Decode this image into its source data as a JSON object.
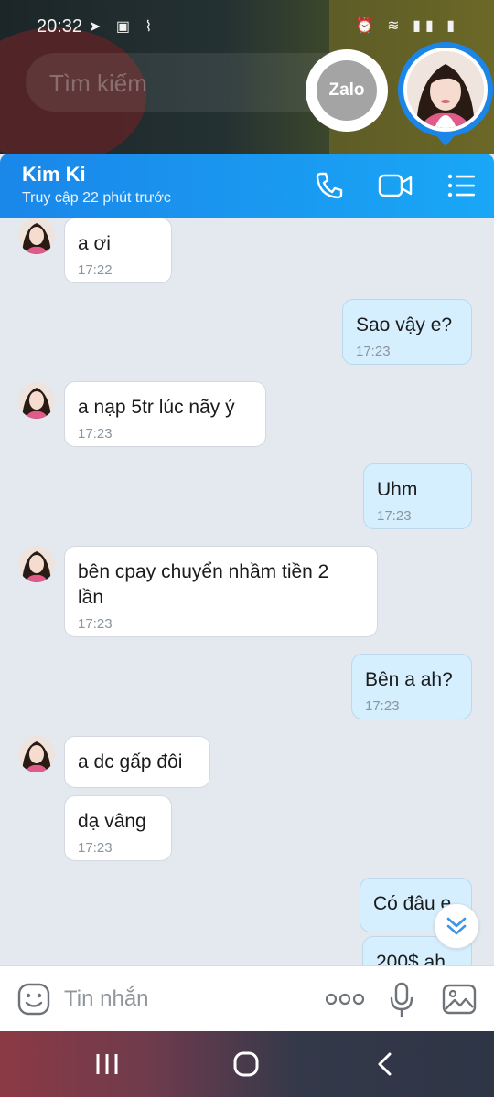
{
  "status_bar": {
    "time": "20:32"
  },
  "search": {
    "placeholder": "Tìm kiếm"
  },
  "zalo_bubble": {
    "label": "Zalo"
  },
  "header": {
    "name": "Kim Ki",
    "last_seen": "Truy cập 22 phút trước"
  },
  "messages": [
    {
      "side": "in",
      "text": "a ơi",
      "time": "17:22"
    },
    {
      "side": "out",
      "text": "Sao vậy e?",
      "time": "17:23"
    },
    {
      "side": "in",
      "text": "a nạp 5tr lúc nãy ý",
      "time": "17:23"
    },
    {
      "side": "out",
      "text": "Uhm",
      "time": "17:23"
    },
    {
      "side": "in",
      "text_line1": "bên cpay chuyển nhầm tiền 2",
      "text_line2": "lần",
      "time": "17:23"
    },
    {
      "side": "out",
      "text": "Bên a ah?",
      "time": "17:23"
    },
    {
      "side": "in",
      "text": "a dc gấp đôi"
    },
    {
      "side": "in",
      "text": "dạ vâng",
      "time": "17:23"
    },
    {
      "side": "out",
      "text": "Có đâu e"
    },
    {
      "side": "out",
      "text": "200$ ah"
    }
  ],
  "composer": {
    "placeholder": "Tin nhắn"
  },
  "colors": {
    "header_blue": "#1a87e9",
    "incoming_bubble": "#ffffff",
    "outgoing_bubble": "#d5efff",
    "chat_bg": "#e3e9ef"
  },
  "icons": {
    "header": [
      "phone-icon",
      "video-call-icon",
      "menu-list-icon"
    ],
    "composer": [
      "emoji-icon",
      "more-dots-icon",
      "microphone-icon",
      "image-icon"
    ],
    "navbar": [
      "recent-apps-icon",
      "home-icon",
      "back-icon"
    ]
  }
}
